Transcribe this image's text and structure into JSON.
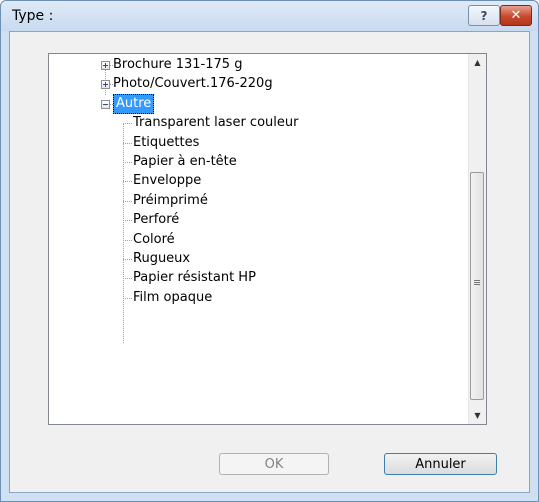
{
  "window": {
    "title": "Type :",
    "help_label": "?",
    "close_label": "✕"
  },
  "tree": {
    "items": [
      {
        "label": "Brochure 131-175 g",
        "expander": "plus",
        "level": 0
      },
      {
        "label": "Photo/Couvert.176-220g",
        "expander": "plus",
        "level": 0
      },
      {
        "label": "Autre",
        "expander": "minus",
        "level": 0,
        "selected": true
      },
      {
        "label": "Transparent laser couleur",
        "level": 1
      },
      {
        "label": "Etiquettes",
        "level": 1
      },
      {
        "label": "Papier à en-tête",
        "level": 1
      },
      {
        "label": "Enveloppe",
        "level": 1
      },
      {
        "label": "Préimprimé",
        "level": 1
      },
      {
        "label": "Perforé",
        "level": 1
      },
      {
        "label": "Coloré",
        "level": 1
      },
      {
        "label": "Rugueux",
        "level": 1
      },
      {
        "label": "Papier résistant HP",
        "level": 1
      },
      {
        "label": "Film opaque",
        "level": 1
      }
    ]
  },
  "scrollbar": {
    "up_icon": "▲",
    "down_icon": "▼",
    "grip_icon": "≡"
  },
  "buttons": {
    "ok_label": "OK",
    "cancel_label": "Annuler"
  }
}
